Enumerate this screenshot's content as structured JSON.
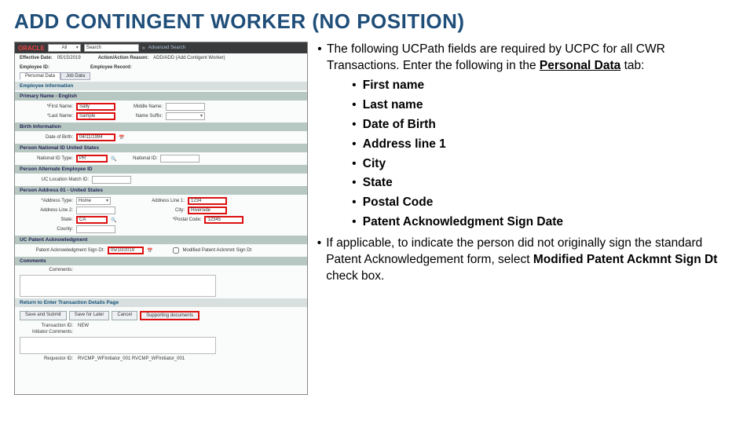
{
  "title": "ADD CONTINGENT WORKER (NO POSITION)",
  "screenshot": {
    "logo": "ORACLE",
    "search_all": "All",
    "search_placeholder": "Search",
    "adv_search": "Advanced Search",
    "eff_date_lbl": "Effective Date:",
    "eff_date_val": "05/15/2019",
    "action_lbl": "Action/Action Reason:",
    "action_val": "ADD/ADD (Add Contigent Worker)",
    "empid_lbl": "Employee ID:",
    "emprec_lbl": "Employee Record:",
    "tab1": "Personal Data",
    "tab2": "Job Data",
    "sect_emp": "Employee Information",
    "sect_name": "Primary Name - English",
    "first_lbl": "*First Name:",
    "first_val": "Sally",
    "middle_lbl": "Middle Name:",
    "last_lbl": "*Last Name:",
    "last_val": "Sample",
    "suffix_lbl": "Name Suffix:",
    "sect_birth": "Birth Information",
    "dob_lbl": "Date of Birth:",
    "dob_val": "04/11/1994",
    "sect_nid": "Person National ID United States",
    "nid_type_lbl": "National ID Type:",
    "nid_type_val": "PR",
    "nid_lbl": "National ID:",
    "sect_alt": "Person Alternate Employee ID",
    "uc_loc_lbl": "UC Location Match ID:",
    "sect_addr": "Person Address 01 - United States",
    "addr_type_lbl": "*Address Type:",
    "addr_type_val": "Home",
    "addr1_lbl": "Address Line 1:",
    "addr1_val": "1234",
    "addr2_lbl": "Address Line 2:",
    "city_lbl": "City:",
    "city_val": "Riverside",
    "state_lbl": "State:",
    "state_val": "CA",
    "postal_lbl": "*Postal Code:",
    "postal_val": "12345",
    "country_lbl": "County:",
    "sect_patent": "UC Patent Acknowledgment",
    "patent_sign_lbl": "Patent Acknowledgment Sign Dt:",
    "patent_sign_val": "05/10/2019",
    "mod_patent_lbl": "Modified Patent Acknmnt Sign Dt",
    "sect_comments": "Comments",
    "comments_lbl": "Comments:",
    "sect_return": "Return to Enter Transaction Details Page",
    "btn_save_submit": "Save and Submit",
    "btn_save_later": "Save for Later",
    "btn_cancel": "Cancel",
    "btn_support": "Supporting documents",
    "trans_id_lbl": "Transaction ID:",
    "trans_id_val": "NEW",
    "init_comments_lbl": "Initiator Comments:",
    "req_id_lbl": "Requestor ID:",
    "req_id_val": "RVCMP_WFInitiator_001   RVCMP_WFInitiator_001"
  },
  "right": {
    "p1_pre": "The following UCPath fields are required by UCPC for all CWR Transactions. Enter the following in the ",
    "p1_bold": "Personal Data",
    "p1_post": " tab:",
    "fields": [
      "First name",
      "Last name",
      "Date of Birth",
      "Address line 1",
      "City",
      "State",
      "Postal Code",
      "Patent Acknowledgment Sign Date"
    ],
    "p2_pre": "If applicable, to indicate the person did not originally sign the standard Patent Acknowledgement form, select ",
    "p2_bold": "Modified Patent Ackmnt Sign Dt",
    "p2_post": " check box."
  }
}
